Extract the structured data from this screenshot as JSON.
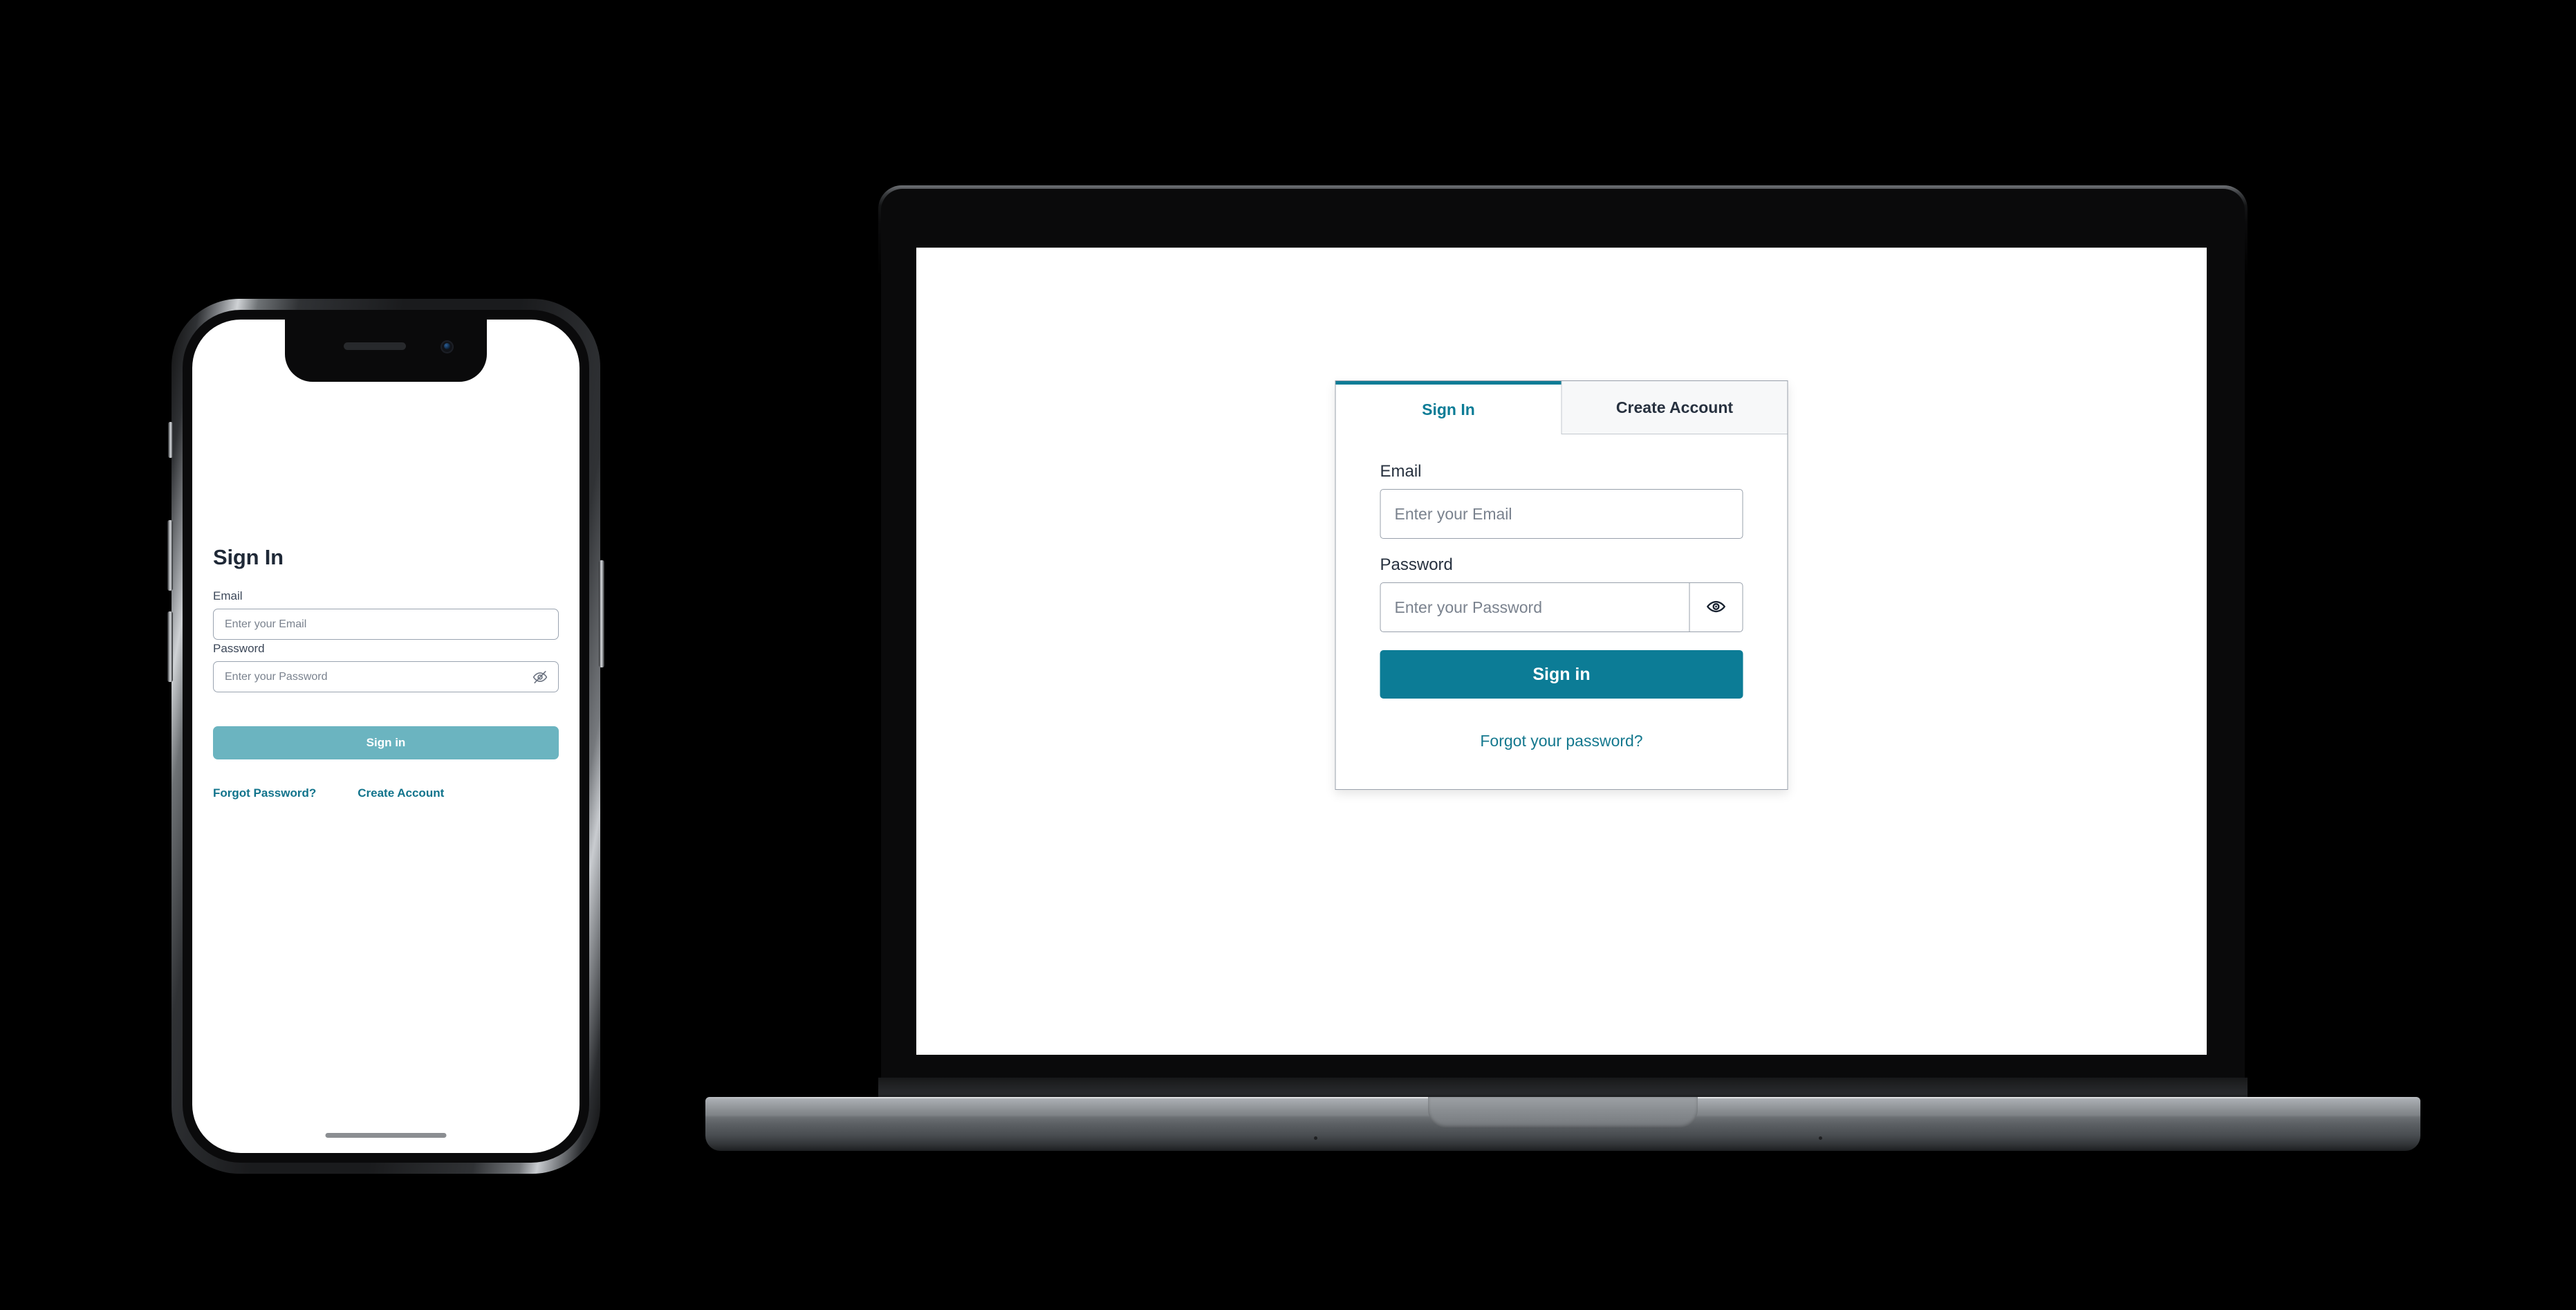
{
  "phone": {
    "title": "Sign In",
    "email": {
      "label": "Email",
      "placeholder": "Enter your Email",
      "value": ""
    },
    "password": {
      "label": "Password",
      "placeholder": "Enter your Password",
      "value": "",
      "toggle_icon": "eye-slash-icon"
    },
    "signin_button": "Sign in",
    "links": [
      {
        "label": "Forgot Password?"
      },
      {
        "label": "Create Account"
      }
    ]
  },
  "laptop": {
    "tabs": [
      {
        "label": "Sign In",
        "active": true
      },
      {
        "label": "Create Account",
        "active": false
      }
    ],
    "email": {
      "label": "Email",
      "placeholder": "Enter your Email",
      "value": ""
    },
    "password": {
      "label": "Password",
      "placeholder": "Enter your Password",
      "value": "",
      "toggle_icon": "eye-icon"
    },
    "signin_button": "Sign in",
    "forgot_link": "Forgot your password?"
  },
  "colors": {
    "background": "#000000",
    "accent_teal": "#0c7c96",
    "link_teal": "#14788e",
    "muted_teal": "#6bb4c0",
    "text_dark": "#27313f",
    "placeholder_gray": "#7a828e",
    "border_gray": "#98a0ab",
    "tab_inactive_bg": "#f7f8f9"
  }
}
